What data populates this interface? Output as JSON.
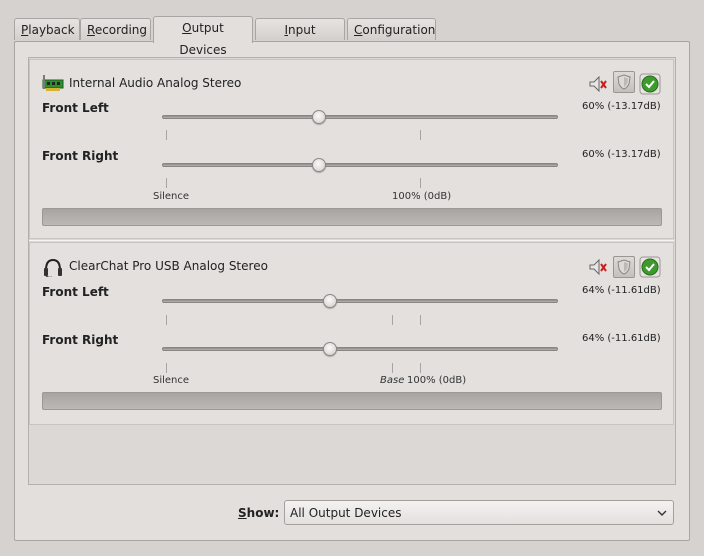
{
  "tabs": [
    {
      "prefix": "",
      "mnemonic": "P",
      "rest": "layback"
    },
    {
      "prefix": "",
      "mnemonic": "R",
      "rest": "ecording"
    },
    {
      "prefix": "",
      "mnemonic": "O",
      "rest": "utput Devices"
    },
    {
      "prefix": "",
      "mnemonic": "I",
      "rest": "nput Devices"
    },
    {
      "prefix": "",
      "mnemonic": "C",
      "rest": "onfiguration"
    }
  ],
  "active_tab": "Output Devices",
  "devices": [
    {
      "name": "Internal Audio Analog Stereo",
      "icon": "sound-card-icon",
      "channels": [
        {
          "label": "Front Left",
          "level_text": "60% (-13.17dB)",
          "level": 0.6
        },
        {
          "label": "Front Right",
          "level_text": "60% (-13.17dB)",
          "level": 0.6
        }
      ],
      "scale": {
        "silence": "Silence",
        "full": "100% (0dB)"
      },
      "meter_level": 0
    },
    {
      "name": "ClearChat Pro USB Analog Stereo",
      "icon": "headset-icon",
      "channels": [
        {
          "label": "Front Left",
          "level_text": "64% (-11.61dB)",
          "level": 0.64
        },
        {
          "label": "Front Right",
          "level_text": "64% (-11.61dB)",
          "level": 0.64
        }
      ],
      "scale": {
        "silence": "Silence",
        "base": "Base",
        "full": "100% (0dB)"
      },
      "meter_level": 0
    }
  ],
  "show": {
    "mnemonic": "S",
    "rest": "how:",
    "value": "All Output Devices"
  },
  "colors": {
    "default_green": "#3f9a2d",
    "mute_red": "#cc1e1e",
    "meter_bg": "#aeaaa7"
  }
}
